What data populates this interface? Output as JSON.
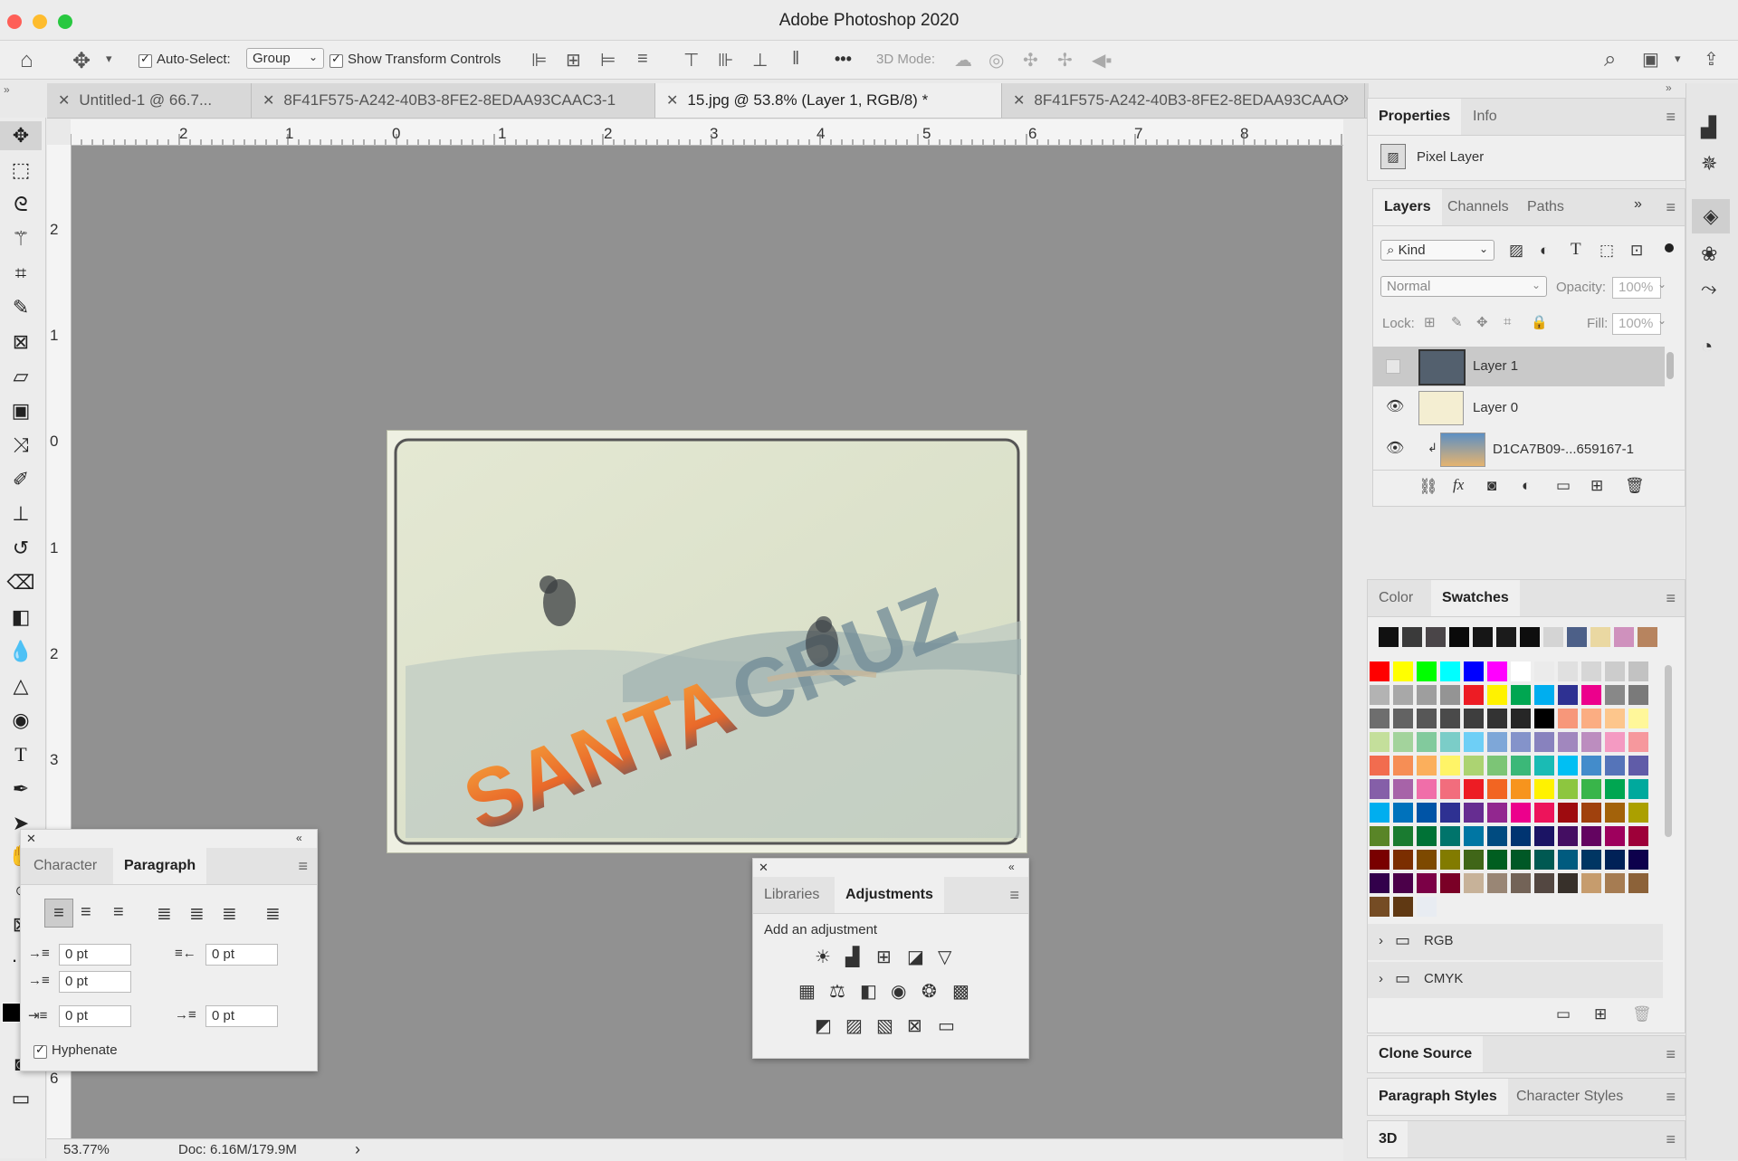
{
  "window": {
    "title": "Adobe Photoshop 2020"
  },
  "options_bar": {
    "auto_select_label": "Auto-Select:",
    "auto_select_value": "Group",
    "show_transform_label": "Show Transform Controls",
    "more_label": "•••",
    "mode_3d_label": "3D Mode:"
  },
  "tabs": [
    {
      "label": "Untitled-1 @ 66.7...",
      "active": false
    },
    {
      "label": "8F41F575-A242-40B3-8FE2-8EDAA93CAAC3-1",
      "active": false
    },
    {
      "label": "15.jpg @ 53.8% (Layer 1, RGB/8) *",
      "active": true
    },
    {
      "label": "8F41F575-A242-40B3-8FE2-8EDAA93CAAC",
      "active": false
    }
  ],
  "rulers": {
    "top": [
      "2",
      "1",
      "0",
      "1",
      "2",
      "3",
      "4",
      "5",
      "6",
      "7",
      "8"
    ],
    "left": [
      "2",
      "1",
      "0",
      "1",
      "2",
      "3",
      "6"
    ]
  },
  "document": {
    "text": "SANTA CRUZ"
  },
  "status": {
    "zoom": "53.77%",
    "doc": "Doc: 6.16M/179.9M",
    "arrow": "›"
  },
  "properties_panel": {
    "tabs": [
      "Properties",
      "Info"
    ],
    "type_label": "Pixel Layer"
  },
  "layers_panel": {
    "tabs": [
      "Layers",
      "Channels",
      "Paths"
    ],
    "filter_kind": "Kind",
    "blend_mode": "Normal",
    "opacity_label": "Opacity:",
    "opacity_value": "100%",
    "lock_label": "Lock:",
    "fill_label": "Fill:",
    "fill_value": "100%",
    "layers": [
      {
        "name": "Layer 1",
        "visible": false,
        "selected": true
      },
      {
        "name": "Layer 0",
        "visible": true,
        "selected": false
      },
      {
        "name": "D1CA7B09-...659167-1",
        "visible": true,
        "selected": false
      }
    ]
  },
  "swatches_panel": {
    "tabs": [
      "Color",
      "Swatches"
    ],
    "recent": [
      "#111111",
      "#3a3a3a",
      "#4a4548",
      "#0a0a0a",
      "#161616",
      "#1b1b1b",
      "#0e0e0e",
      "#d4d4d4",
      "#4d6088",
      "#ead8a2",
      "#cf91bd",
      "#b7845f"
    ],
    "grid": [
      [
        "#ff0000",
        "#ffff00",
        "#00ff00",
        "#00ffff",
        "#0000ff",
        "#ff00ff",
        "#ffffff",
        "#ebebeb",
        "#e0e0e0",
        "#d6d6d6",
        "#cccccc",
        "#c2c2c2"
      ],
      [
        "#b3b3b3",
        "#a8a8a8",
        "#9e9e9e",
        "#949494",
        "#ed1c24",
        "#fff200",
        "#00a651",
        "#00aeef",
        "#2e3192",
        "#ec008c",
        "#888888",
        "#7a7a7a"
      ],
      [
        "#6e6e6e",
        "#636363",
        "#575757",
        "#4a4a4a",
        "#3e3e3e",
        "#333333",
        "#262626",
        "#000000",
        "#f7977a",
        "#fbad82",
        "#fdc68c",
        "#fff79a"
      ],
      [
        "#c4df9b",
        "#a3d39c",
        "#82ca9d",
        "#7bcdc8",
        "#6ecff6",
        "#7ea7d8",
        "#8493ca",
        "#8882be",
        "#a187be",
        "#bc8dbf",
        "#f49ac2",
        "#f6989d"
      ],
      [
        "#f26c4f",
        "#f68e55",
        "#fbaf5c",
        "#fff467",
        "#acd372",
        "#7cc576",
        "#3bb878",
        "#1abbb4",
        "#00bff3",
        "#438ccb",
        "#5574b9",
        "#605ca8"
      ],
      [
        "#855fa8",
        "#a763a8",
        "#f06ea9",
        "#f26d7d",
        "#ed1c24",
        "#f26522",
        "#f7941d",
        "#fff200",
        "#8dc63f",
        "#39b54a",
        "#00a651",
        "#00a99d"
      ],
      [
        "#00aeef",
        "#0072bc",
        "#0054a6",
        "#2e3192",
        "#662d91",
        "#92278f",
        "#ec008c",
        "#ed145b",
        "#9e0b0f",
        "#a0410d",
        "#a3620a",
        "#aba000"
      ],
      [
        "#598527",
        "#1a7b30",
        "#007236",
        "#00746b",
        "#0076a3",
        "#004b80",
        "#003471",
        "#1b1464",
        "#440e62",
        "#630460",
        "#9e005d",
        "#9e0039"
      ],
      [
        "#790000",
        "#7b2e00",
        "#7d4900",
        "#827b00",
        "#406618",
        "#005e20",
        "#005826",
        "#005952",
        "#005b7f",
        "#003663",
        "#002157",
        "#0d004c"
      ],
      [
        "#32004b",
        "#4b0049",
        "#7b0046",
        "#7a0026",
        "#c7b299",
        "#998675",
        "#736357",
        "#534741",
        "#37302a",
        "#c69c6d",
        "#a67c52",
        "#8c6239"
      ],
      [
        "#754c24",
        "#603913",
        "#e8ecf2"
      ]
    ],
    "groups": [
      "RGB",
      "CMYK"
    ]
  },
  "clone_source_panel": {
    "tab": "Clone Source"
  },
  "styles_panel": {
    "tabs": [
      "Paragraph Styles",
      "Character Styles"
    ]
  },
  "panel_3d": {
    "tab": "3D"
  },
  "paragraph_panel": {
    "tabs": [
      "Character",
      "Paragraph"
    ],
    "indent_left": "0 pt",
    "indent_right": "0 pt",
    "indent_first": "0 pt",
    "space_before": "0 pt",
    "space_after": "0 pt",
    "hyphenate_label": "Hyphenate"
  },
  "adjustments_panel": {
    "tabs": [
      "Libraries",
      "Adjustments"
    ],
    "heading": "Add an adjustment"
  },
  "colors": {
    "canvas_bg": "#919191",
    "close_light": "#fe5f57",
    "min_light": "#febc2e",
    "max_light": "#28c840"
  }
}
